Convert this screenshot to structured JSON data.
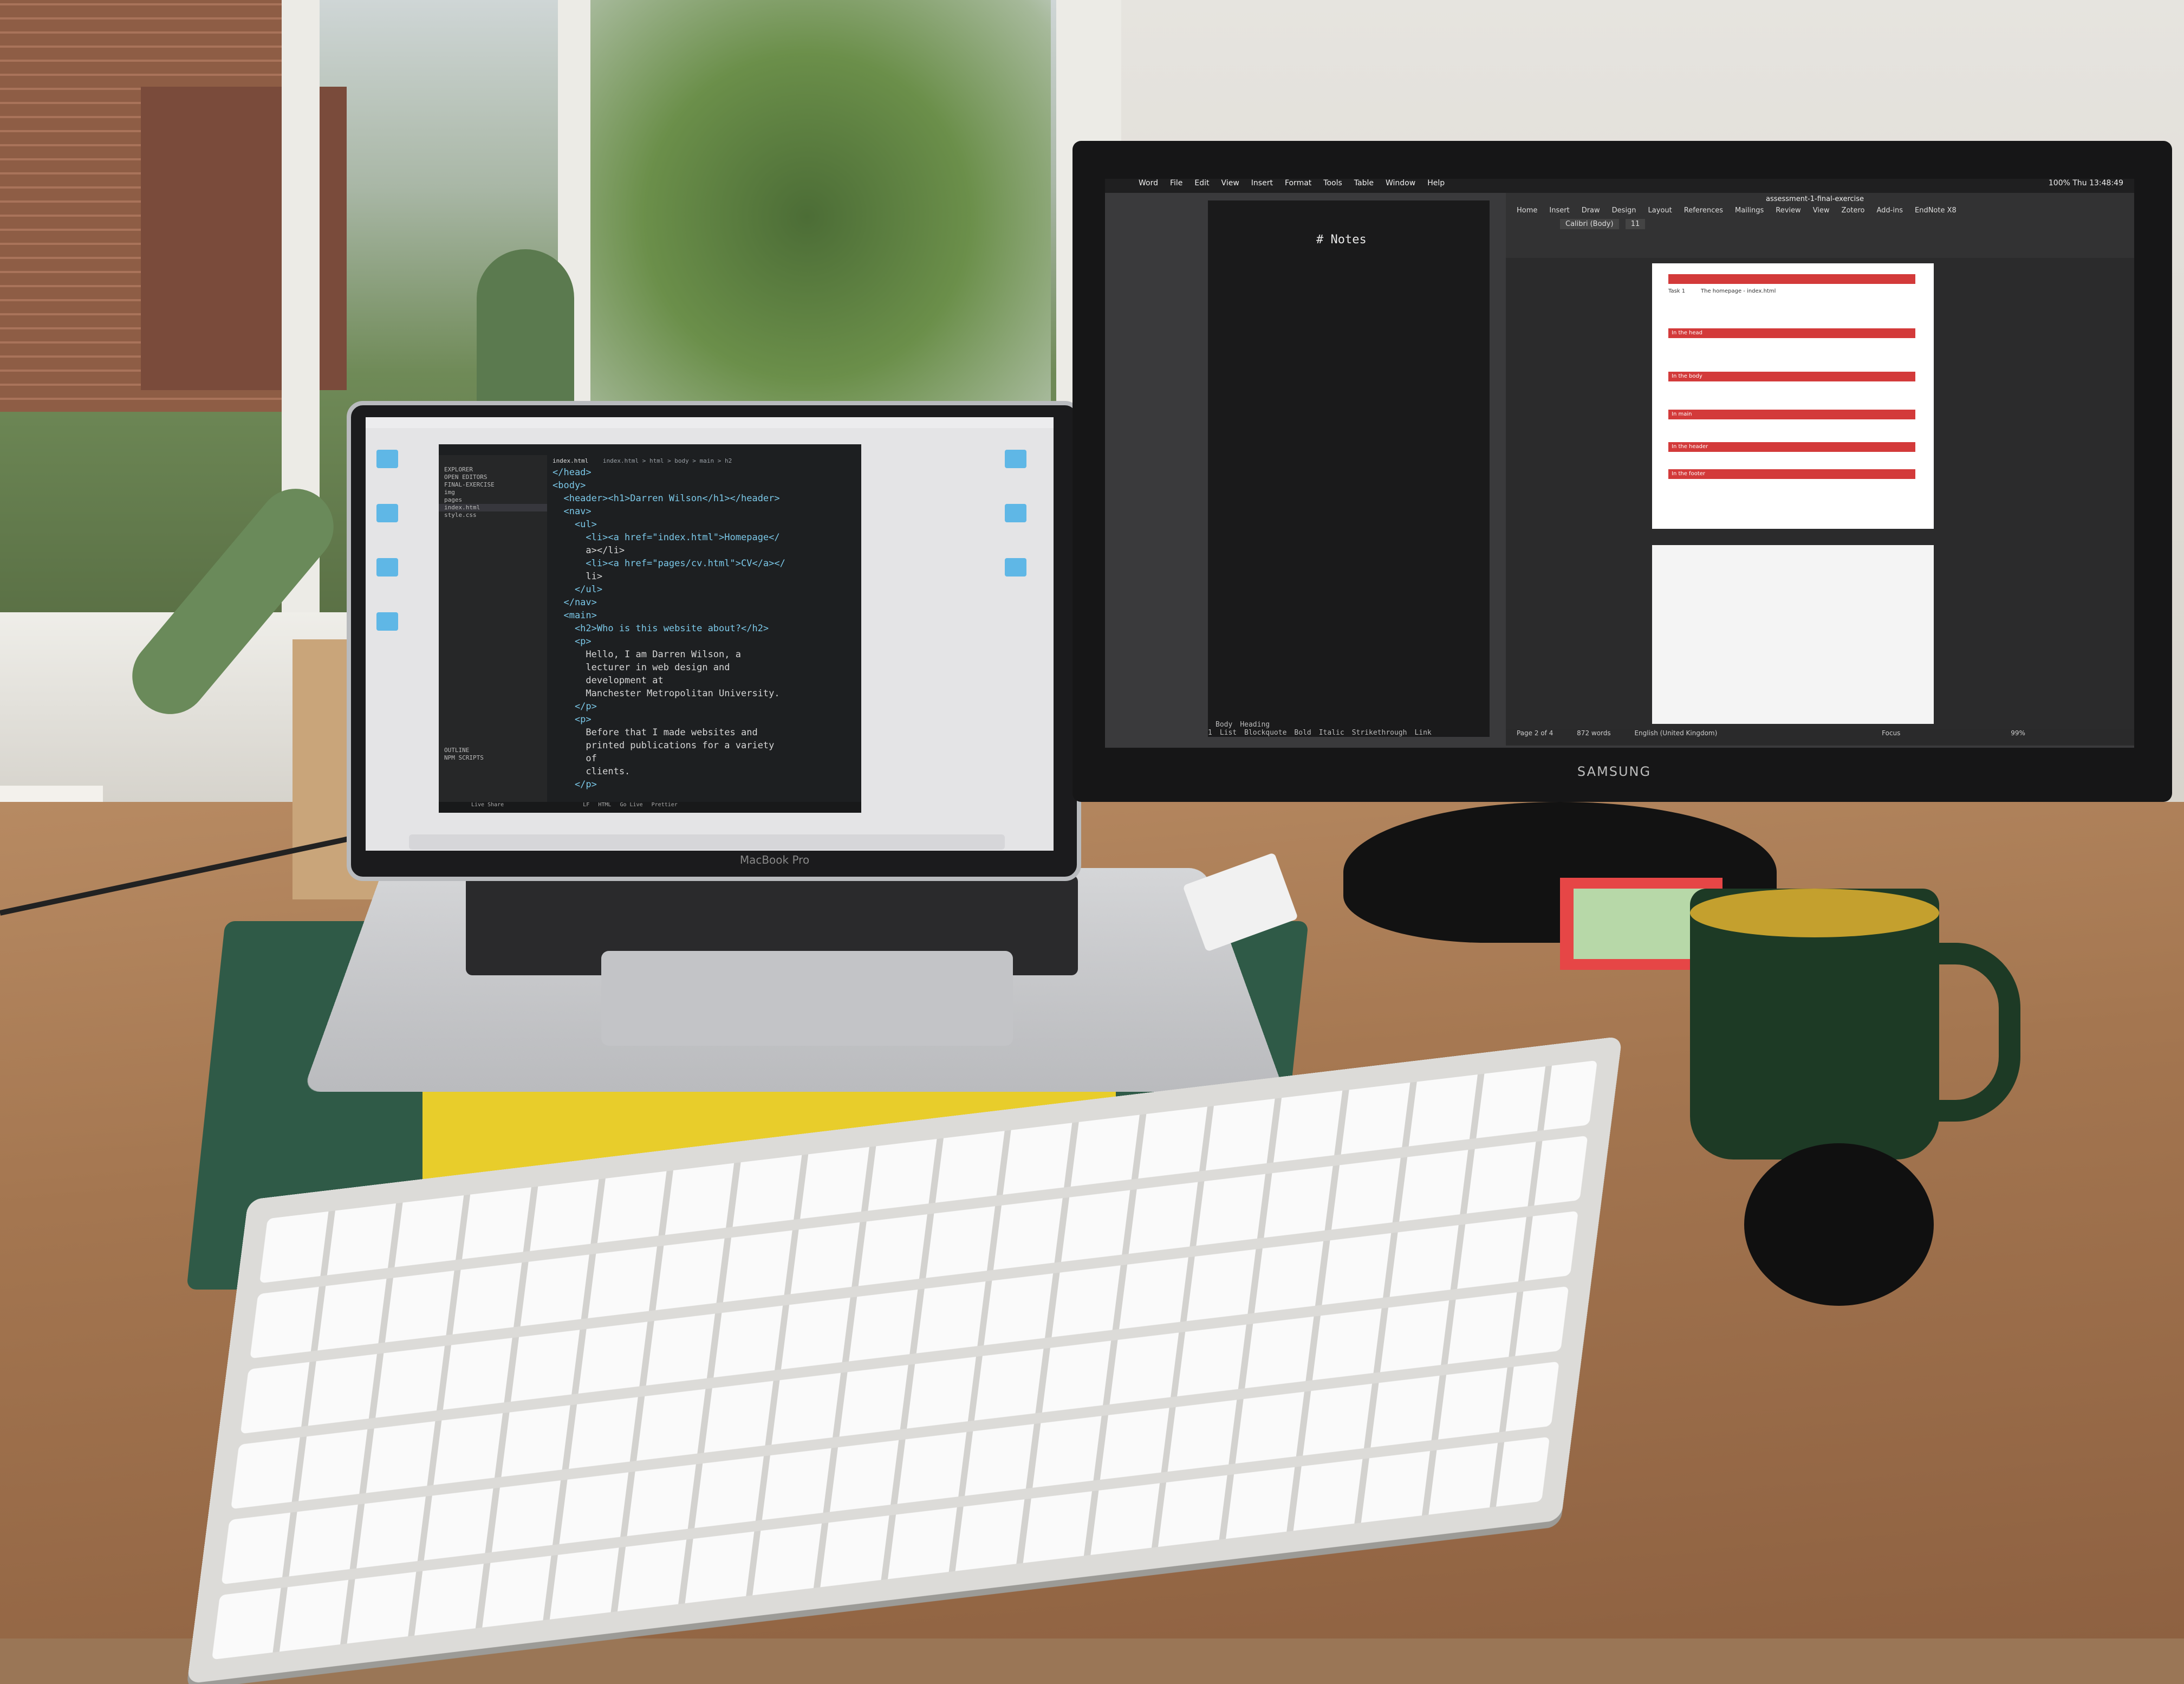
{
  "laptop": {
    "brand_label": "MacBook Pro",
    "editor": {
      "tab_title": "index.html",
      "breadcrumb": "index.html > html > body > main > h2",
      "sidebar": [
        "EXPLORER",
        "OPEN EDITORS",
        "FINAL-EXERCISE",
        "img",
        "pages",
        "index.html",
        "style.css",
        "OUTLINE",
        "NPM SCRIPTS"
      ],
      "code_lines": [
        "</head>",
        "<body>",
        "  <header><h1>Darren Wilson</h1></header>",
        "  <nav>",
        "    <ul>",
        "      <li><a href=\"index.html\">Homepage</",
        "      a></li>",
        "      <li><a href=\"pages/cv.html\">CV</a></",
        "      li>",
        "    </ul>",
        "  </nav>",
        "  <main>",
        "    <h2>Who is this website about?</h2>",
        "    <p>",
        "      Hello, I am Darren Wilson, a",
        "      lecturer in web design and",
        "      development at",
        "      Manchester Metropolitan University.",
        "    </p>",
        "    <p>",
        "      Before that I made websites and",
        "      printed publications for a variety",
        "      of",
        "      clients.",
        "    </p>"
      ],
      "status_left": "Live Share",
      "status_right": [
        "LF",
        "HTML",
        "Go Live",
        "Prettier"
      ]
    }
  },
  "monitor": {
    "brand_label": "SAMSUNG",
    "menubar": [
      "Word",
      "File",
      "Edit",
      "View",
      "Insert",
      "Format",
      "Tools",
      "Table",
      "Window",
      "Help"
    ],
    "clock": "Thu 13:48:49",
    "battery": "100%",
    "notes": {
      "heading": "# Notes",
      "footer": [
        "Body",
        "Heading 1",
        "List",
        "Blockquote",
        "Bold",
        "Italic",
        "Strikethrough",
        "Link"
      ]
    },
    "word": {
      "doc_title": "assessment-1-final-exercise",
      "tabs": [
        "Home",
        "Insert",
        "Draw",
        "Design",
        "Layout",
        "References",
        "Mailings",
        "Review",
        "View",
        "Zotero",
        "Add-ins",
        "EndNote X8"
      ],
      "font": "Calibri (Body)",
      "font_size": "11",
      "page_lines": [
        "Task 1",
        "The homepage - index.html",
        "In the head",
        "In the body",
        "In main",
        "In the header",
        "In the footer"
      ],
      "status": [
        "Page 2 of 4",
        "872 words",
        "English (United Kingdom)",
        "Focus",
        "99%"
      ]
    }
  },
  "colors": {
    "desk": "#a47650",
    "mug_inner": "#c4a02e",
    "mug": "#1d3a25",
    "word_highlight": "#d33a3a"
  }
}
